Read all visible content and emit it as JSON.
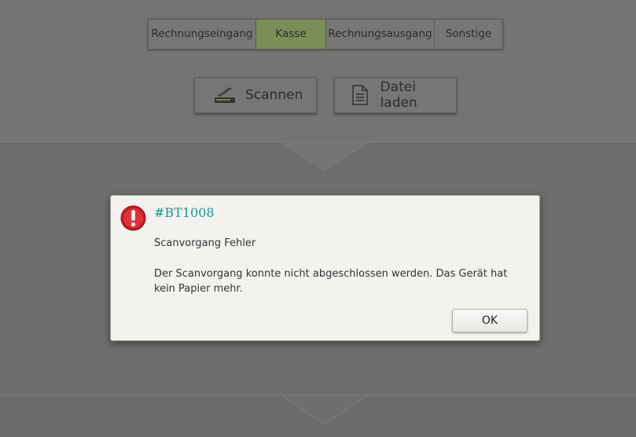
{
  "tabs": [
    {
      "label": "Rechnungseingang",
      "active": false
    },
    {
      "label": "Kasse",
      "active": true
    },
    {
      "label": "Rechnungsausgang",
      "active": false
    },
    {
      "label": "Sonstige",
      "active": false
    }
  ],
  "actions": {
    "scan_label": "Scannen",
    "scan_icon": "scanner-icon",
    "file_label": "Datei laden",
    "file_icon": "document-icon"
  },
  "dialog": {
    "icon": "error-icon",
    "title": "#BT1008",
    "heading": "Scanvorgang Fehler",
    "message": "Der Scanvorgang konnte nicht abgeschlossen werden. Das Gerät hat kein Papier mehr.",
    "ok_label": "OK"
  },
  "colors": {
    "accent_active_tab": "#7b8e58",
    "error_red": "#d0202a",
    "title_teal": "#199a95"
  }
}
